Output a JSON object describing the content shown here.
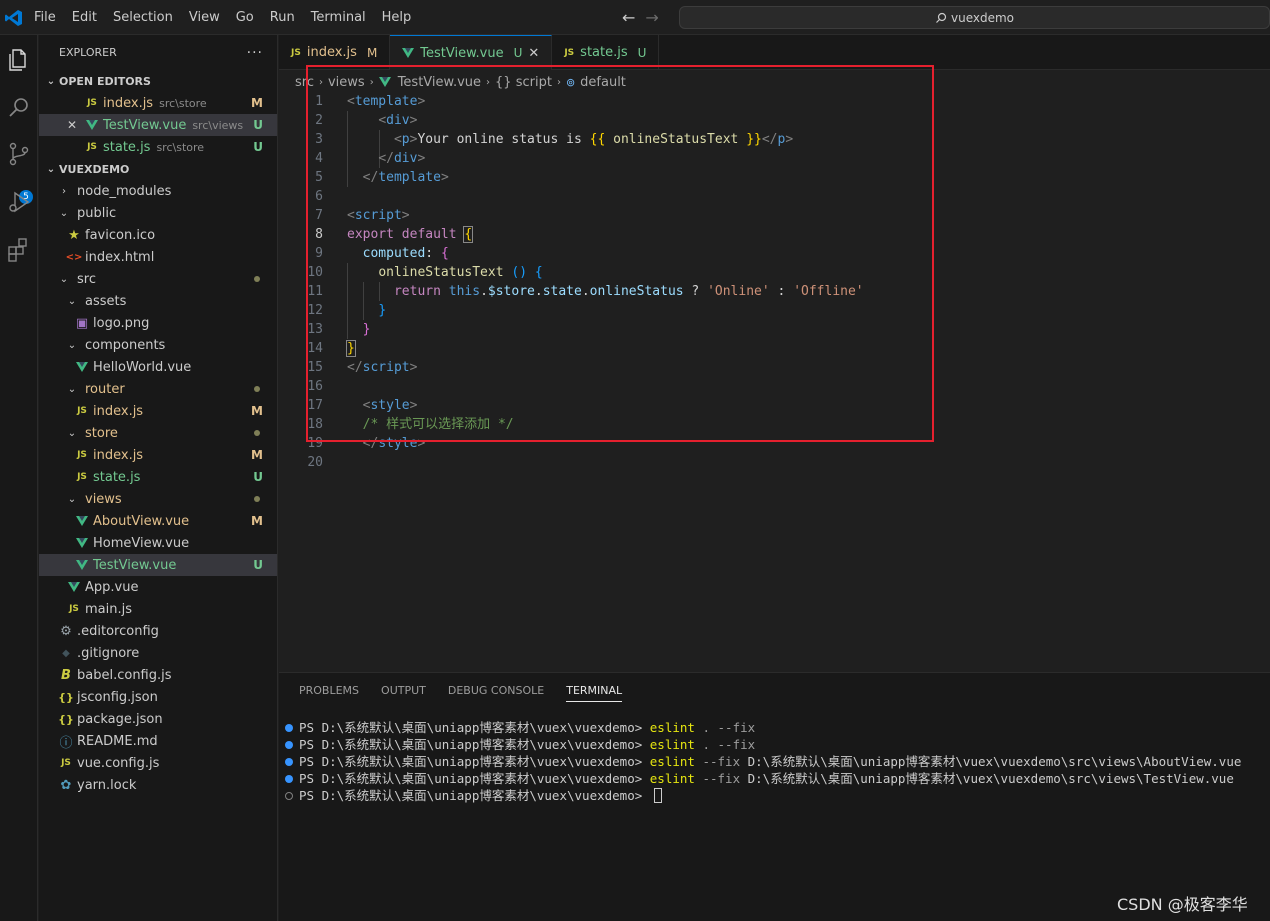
{
  "menu": [
    "File",
    "Edit",
    "Selection",
    "View",
    "Go",
    "Run",
    "Terminal",
    "Help"
  ],
  "search_text": "vuexdemo",
  "scm_badge": "5",
  "explorer": {
    "title": "EXPLORER",
    "more": "···",
    "open_editors_title": "OPEN EDITORS",
    "open_editors": [
      {
        "name": "index.js",
        "desc": "src\\store",
        "status": "M",
        "kind": "js"
      },
      {
        "name": "TestView.vue",
        "desc": "src\\views",
        "status": "U",
        "kind": "vue"
      },
      {
        "name": "state.js",
        "desc": "src\\store",
        "status": "U",
        "kind": "js"
      }
    ],
    "project_title": "VUEXDEMO",
    "tree": [
      {
        "name": "node_modules",
        "kind": "folder-closed",
        "depth": 0
      },
      {
        "name": "public",
        "kind": "folder-open",
        "depth": 0
      },
      {
        "name": "favicon.ico",
        "kind": "star",
        "depth": 1
      },
      {
        "name": "index.html",
        "kind": "html",
        "depth": 1
      },
      {
        "name": "src",
        "kind": "folder-open",
        "depth": 0,
        "dot": true
      },
      {
        "name": "assets",
        "kind": "folder-open",
        "depth": 1
      },
      {
        "name": "logo.png",
        "kind": "img",
        "depth": 2
      },
      {
        "name": "components",
        "kind": "folder-open",
        "depth": 1
      },
      {
        "name": "HelloWorld.vue",
        "kind": "vue",
        "depth": 2
      },
      {
        "name": "router",
        "kind": "folder-open",
        "depth": 1,
        "dot": true,
        "color": "mod"
      },
      {
        "name": "index.js",
        "kind": "js",
        "depth": 2,
        "status": "M",
        "color": "mod"
      },
      {
        "name": "store",
        "kind": "folder-open",
        "depth": 1,
        "dot": true,
        "color": "mod"
      },
      {
        "name": "index.js",
        "kind": "js",
        "depth": 2,
        "status": "M",
        "color": "mod"
      },
      {
        "name": "state.js",
        "kind": "js",
        "depth": 2,
        "status": "U",
        "color": "untr"
      },
      {
        "name": "views",
        "kind": "folder-open",
        "depth": 1,
        "dot": true,
        "color": "mod"
      },
      {
        "name": "AboutView.vue",
        "kind": "vue",
        "depth": 2,
        "status": "M",
        "color": "mod"
      },
      {
        "name": "HomeView.vue",
        "kind": "vue",
        "depth": 2
      },
      {
        "name": "TestView.vue",
        "kind": "vue",
        "depth": 2,
        "status": "U",
        "color": "untr",
        "selected": true
      },
      {
        "name": "App.vue",
        "kind": "vue",
        "depth": 1
      },
      {
        "name": "main.js",
        "kind": "js",
        "depth": 1
      },
      {
        "name": ".editorconfig",
        "kind": "gear",
        "depth": 0
      },
      {
        "name": ".gitignore",
        "kind": "git",
        "depth": 0
      },
      {
        "name": "babel.config.js",
        "kind": "babel",
        "depth": 0
      },
      {
        "name": "jsconfig.json",
        "kind": "json",
        "depth": 0
      },
      {
        "name": "package.json",
        "kind": "json",
        "depth": 0
      },
      {
        "name": "README.md",
        "kind": "info",
        "depth": 0
      },
      {
        "name": "vue.config.js",
        "kind": "js",
        "depth": 0
      },
      {
        "name": "yarn.lock",
        "kind": "yarn",
        "depth": 0
      }
    ]
  },
  "tabs": [
    {
      "name": "index.js",
      "status": "M",
      "kind": "js",
      "active": false
    },
    {
      "name": "TestView.vue",
      "status": "U",
      "kind": "vue",
      "active": true
    },
    {
      "name": "state.js",
      "status": "U",
      "kind": "js",
      "active": false
    }
  ],
  "breadcrumb": [
    "src",
    "views",
    "TestView.vue",
    "{} script",
    "default"
  ],
  "code_lines": [
    {
      "n": "1",
      "html": "<span class='tk-br'>&lt;</span><span class='tk-tag'>template</span><span class='tk-br'>&gt;</span>"
    },
    {
      "n": "2",
      "html": "    <span class='tk-br'>&lt;</span><span class='tk-tag'>div</span><span class='tk-br'>&gt;</span>"
    },
    {
      "n": "3",
      "html": "      <span class='tk-br'>&lt;</span><span class='tk-tag'>p</span><span class='tk-br'>&gt;</span><span class='tk-txt'>Your online status is </span><span class='tk-y'>{{</span><span class='tk-fn'> onlineStatusText </span><span class='tk-y'>}}</span><span class='tk-br'>&lt;/</span><span class='tk-tag'>p</span><span class='tk-br'>&gt;</span>"
    },
    {
      "n": "4",
      "html": "    <span class='tk-br'>&lt;/</span><span class='tk-tag'>div</span><span class='tk-br'>&gt;</span>"
    },
    {
      "n": "5",
      "html": "  <span class='tk-br'>&lt;/</span><span class='tk-tag'>template</span><span class='tk-br'>&gt;</span>"
    },
    {
      "n": "6",
      "html": ""
    },
    {
      "n": "7",
      "html": "<span class='tk-br'>&lt;</span><span class='tk-tag'>script</span><span class='tk-br'>&gt;</span>"
    },
    {
      "n": "8",
      "html": "<span class='tk-kw'>export</span> <span class='tk-kw'>default</span> <span class='tk-y' style='outline:1px solid #888'>{</span>"
    },
    {
      "n": "9",
      "html": "  <span class='tk-prop'>computed</span><span class='tk-txt'>: </span><span class='tk-p'>{</span>"
    },
    {
      "n": "10",
      "html": "    <span class='tk-fn'>onlineStatusText</span> <span class='tk-b'>()</span> <span class='tk-b'>{</span>"
    },
    {
      "n": "11",
      "html": "      <span class='tk-kw'>return</span> <span class='tk-this'>this</span><span class='tk-txt'>.</span><span class='tk-prop'>$store</span><span class='tk-txt'>.</span><span class='tk-prop'>state</span><span class='tk-txt'>.</span><span class='tk-prop'>onlineStatus</span><span class='tk-txt'> ? </span><span class='tk-str'>'Online'</span><span class='tk-txt'> : </span><span class='tk-str'>'Offline'</span>"
    },
    {
      "n": "12",
      "html": "    <span class='tk-b'>}</span>"
    },
    {
      "n": "13",
      "html": "  <span class='tk-p'>}</span>"
    },
    {
      "n": "14",
      "html": "<span class='tk-y' style='outline:1px solid #888'>}</span>"
    },
    {
      "n": "15",
      "html": "<span class='tk-br'>&lt;/</span><span class='tk-tag'>script</span><span class='tk-br'>&gt;</span>"
    },
    {
      "n": "16",
      "html": ""
    },
    {
      "n": "17",
      "html": "  <span class='tk-br'>&lt;</span><span class='tk-tag'>style</span><span class='tk-br'>&gt;</span>"
    },
    {
      "n": "18",
      "html": "  <span class='tk-cm'>/* 样式可以选择添加 */</span>"
    },
    {
      "n": "19",
      "html": "  <span class='tk-br'>&lt;/</span><span class='tk-tag'>style</span><span class='tk-br'>&gt;</span>"
    },
    {
      "n": "20",
      "html": ""
    }
  ],
  "panel_tabs": [
    "PROBLEMS",
    "OUTPUT",
    "DEBUG CONSOLE",
    "TERMINAL"
  ],
  "terminal": {
    "prompt": "PS D:\\系统默认\\桌面\\uniapp博客素材\\vuex\\vuexdemo> ",
    "lines": [
      {
        "cmd": "eslint",
        "args": " . --fix",
        "path": ""
      },
      {
        "cmd": "eslint",
        "args": " . --fix",
        "path": ""
      },
      {
        "cmd": "eslint",
        "args": " --fix ",
        "path": "D:\\系统默认\\桌面\\uniapp博客素材\\vuex\\vuexdemo\\src\\views\\AboutView.vue"
      },
      {
        "cmd": "eslint",
        "args": " --fix ",
        "path": "D:\\系统默认\\桌面\\uniapp博客素材\\vuex\\vuexdemo\\src\\views\\TestView.vue"
      }
    ]
  },
  "watermark": "CSDN @极客李华"
}
